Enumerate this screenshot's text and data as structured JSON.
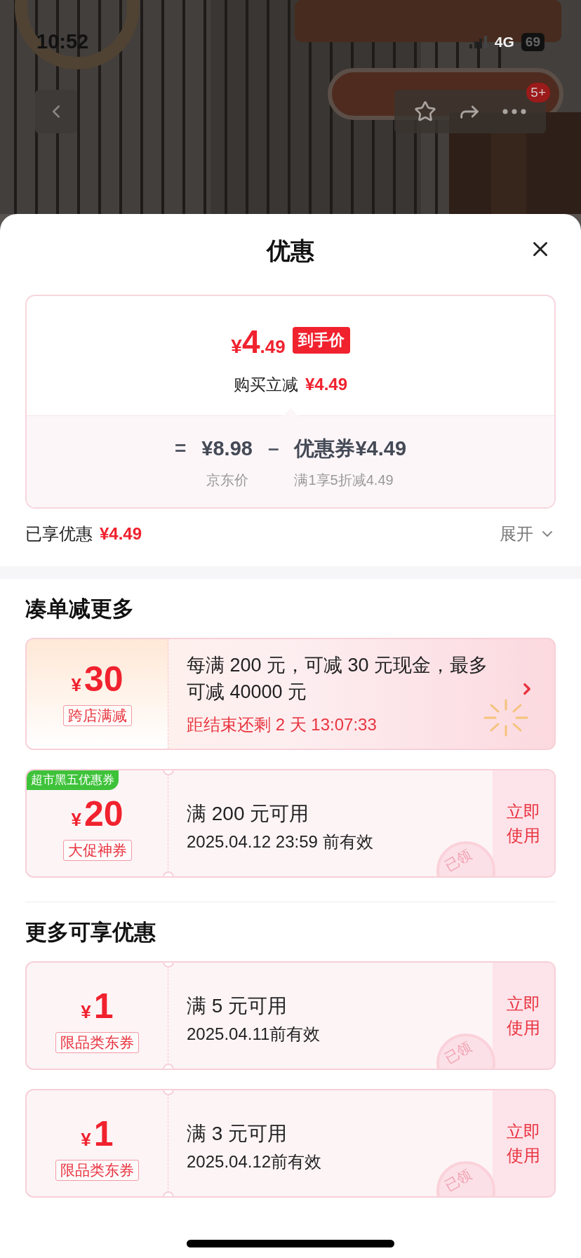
{
  "status_bar": {
    "time": "10:52",
    "network": "4G",
    "battery": "69"
  },
  "nav": {
    "badge": "5+"
  },
  "sheet": {
    "title": "优惠",
    "price_card": {
      "currency": "¥",
      "price_int": "4",
      "price_dec": ".49",
      "price_tag": "到手价",
      "reduce_label": "购买立减",
      "reduce_amount": "¥4.49",
      "formula": {
        "equals": "=",
        "base": "¥8.98",
        "base_label": "京东价",
        "minus": "–",
        "coupon": "优惠券¥4.49",
        "coupon_label": "满1享5折减4.49"
      }
    },
    "enjoyed": {
      "label": "已享优惠",
      "amount": "¥4.49",
      "toggle": "展开",
      "expanded": false
    },
    "sections": [
      {
        "title": "凑单减更多",
        "items": [
          {
            "kind": "promo",
            "currency": "¥",
            "amount": "30",
            "tag": "跨店满减",
            "text": "每满 200 元，可减 30 元现金，最多可减 40000 元",
            "countdown": "距结束还剩 2 天 13:07:33"
          },
          {
            "kind": "coupon",
            "badge": "超市黑五优惠券",
            "currency": "¥",
            "amount": "20",
            "tag": "大促神券",
            "text": "满 200 元可用",
            "validity": "2025.04.12 23:59 前有效",
            "action": "立即使用",
            "stamp": "已领"
          }
        ]
      },
      {
        "title": "更多可享优惠",
        "items": [
          {
            "kind": "coupon",
            "currency": "¥",
            "amount": "1",
            "tag": "限品类东券",
            "text": "满 5 元可用",
            "validity": "2025.04.11前有效",
            "action": "立即使用",
            "stamp": "已领"
          },
          {
            "kind": "coupon",
            "currency": "¥",
            "amount": "1",
            "tag": "限品类东券",
            "text": "满 3 元可用",
            "validity": "2025.04.12前有效",
            "action": "立即使用",
            "stamp": "已领"
          }
        ]
      }
    ]
  }
}
